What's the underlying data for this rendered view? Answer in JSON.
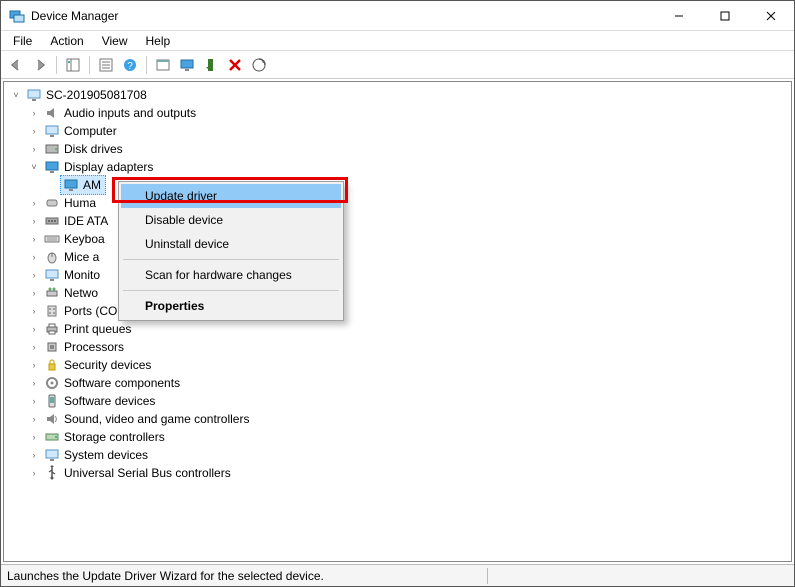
{
  "window": {
    "title": "Device Manager"
  },
  "menubar": {
    "items": [
      "File",
      "Action",
      "View",
      "Help"
    ]
  },
  "toolbar": {
    "icons": [
      "back",
      "forward",
      "show-hide-tree",
      "properties",
      "help",
      "action-box",
      "display",
      "enable",
      "delete",
      "scan"
    ]
  },
  "tree": {
    "root": {
      "label": "SC-201905081708",
      "expanded": true,
      "icon": "computer",
      "children": [
        {
          "label": "Audio inputs and outputs",
          "icon": "audio",
          "expandable": true
        },
        {
          "label": "Computer",
          "icon": "computer",
          "expandable": true
        },
        {
          "label": "Disk drives",
          "icon": "disk",
          "expandable": true
        },
        {
          "label": "Display adapters",
          "icon": "display",
          "expandable": true,
          "expanded": true,
          "children": [
            {
              "label": "AM",
              "icon": "display",
              "selected": true
            }
          ]
        },
        {
          "label": "Huma",
          "icon": "hid",
          "expandable": true,
          "truncated": true
        },
        {
          "label": "IDE ATA",
          "icon": "ide",
          "expandable": true,
          "truncated": true
        },
        {
          "label": "Keyboa",
          "icon": "keyboard",
          "expandable": true,
          "truncated": true
        },
        {
          "label": "Mice a",
          "icon": "mouse",
          "expandable": true,
          "truncated": true
        },
        {
          "label": "Monito",
          "icon": "monitor",
          "expandable": true,
          "truncated": true
        },
        {
          "label": "Netwo",
          "icon": "network",
          "expandable": true,
          "truncated": true
        },
        {
          "label": "Ports (COM & LPT)",
          "icon": "ports",
          "expandable": true
        },
        {
          "label": "Print queues",
          "icon": "printer",
          "expandable": true
        },
        {
          "label": "Processors",
          "icon": "cpu",
          "expandable": true
        },
        {
          "label": "Security devices",
          "icon": "security",
          "expandable": true
        },
        {
          "label": "Software components",
          "icon": "software",
          "expandable": true
        },
        {
          "label": "Software devices",
          "icon": "softdev",
          "expandable": true
        },
        {
          "label": "Sound, video and game controllers",
          "icon": "sound",
          "expandable": true
        },
        {
          "label": "Storage controllers",
          "icon": "storage",
          "expandable": true
        },
        {
          "label": "System devices",
          "icon": "system",
          "expandable": true
        },
        {
          "label": "Universal Serial Bus controllers",
          "icon": "usb",
          "expandable": true
        }
      ]
    }
  },
  "context_menu": {
    "items": [
      {
        "label": "Update driver",
        "highlight": true
      },
      {
        "label": "Disable device"
      },
      {
        "label": "Uninstall device"
      },
      {
        "sep": true
      },
      {
        "label": "Scan for hardware changes"
      },
      {
        "sep": true
      },
      {
        "label": "Properties",
        "bold": true
      }
    ]
  },
  "statusbar": {
    "text": "Launches the Update Driver Wizard for the selected device."
  }
}
